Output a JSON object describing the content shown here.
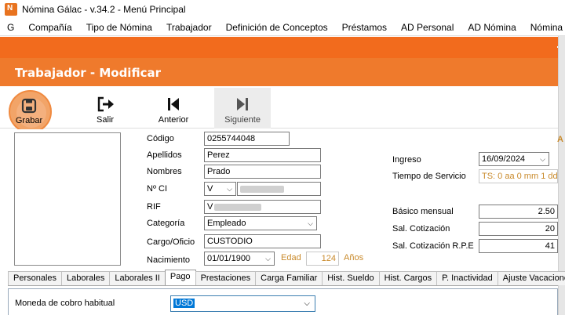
{
  "window": {
    "title": "Nómina Gálac  - v.34.2 - Menú Principal"
  },
  "menu": [
    "G",
    "Compañía",
    "Tipo de Nómina",
    "Trabajador",
    "Definición de Conceptos",
    "Préstamos",
    "AD Personal",
    "AD Nómina",
    "Nómina"
  ],
  "header": {
    "title": "Trabajador - Modificar"
  },
  "toolbar": {
    "grabar": "Grabar",
    "salir": "Salir",
    "anterior": "Anterior",
    "siguiente": "Siguiente"
  },
  "form": {
    "codigo_label": "Código",
    "codigo_value": "0255744048",
    "apellidos_label": "Apellidos",
    "apellidos_value": "Perez",
    "nombres_label": "Nombres",
    "nombres_value": "Prado",
    "ci_label": "Nº CI",
    "ci_type": "V",
    "rif_label": "RIF",
    "rif_prefix": "V",
    "categoria_label": "Categoría",
    "categoria_value": "Empleado",
    "cargo_label": "Cargo/Oficio",
    "cargo_value": "CUSTODIO",
    "nacimiento_label": "Nacimiento",
    "nacimiento_value": "01/01/1900",
    "edad_label": "Edad",
    "edad_value": "124",
    "edad_unit": "Años",
    "ingreso_label": "Ingreso",
    "ingreso_value": "16/09/2024",
    "tiempo_label": "Tiempo de Servicio",
    "tiempo_value": "TS: 0 aa 0 mm 1 dd",
    "basico_label": "Básico mensual",
    "basico_value": "2.50",
    "salcot_label": "Sal. Cotización",
    "salcot_value": "20",
    "salrpe_label": "Sal. Cotización R.P.E",
    "salrpe_value": "41",
    "corner_text": "A"
  },
  "tabs": [
    "Personales",
    "Laborales",
    "Laborales II",
    "Pago",
    "Prestaciones",
    "Carga Familiar",
    "Hist. Sueldo",
    "Hist. Cargos",
    "P. Inactividad",
    "Ajuste Vacaciones"
  ],
  "active_tab": "Pago",
  "pago": {
    "moneda_label": "Moneda de cobro habitual",
    "moneda_value": "USD"
  },
  "colors": {
    "accent": "#ef7a2c",
    "strip": "#f26b1d",
    "selection": "#0078d7"
  }
}
